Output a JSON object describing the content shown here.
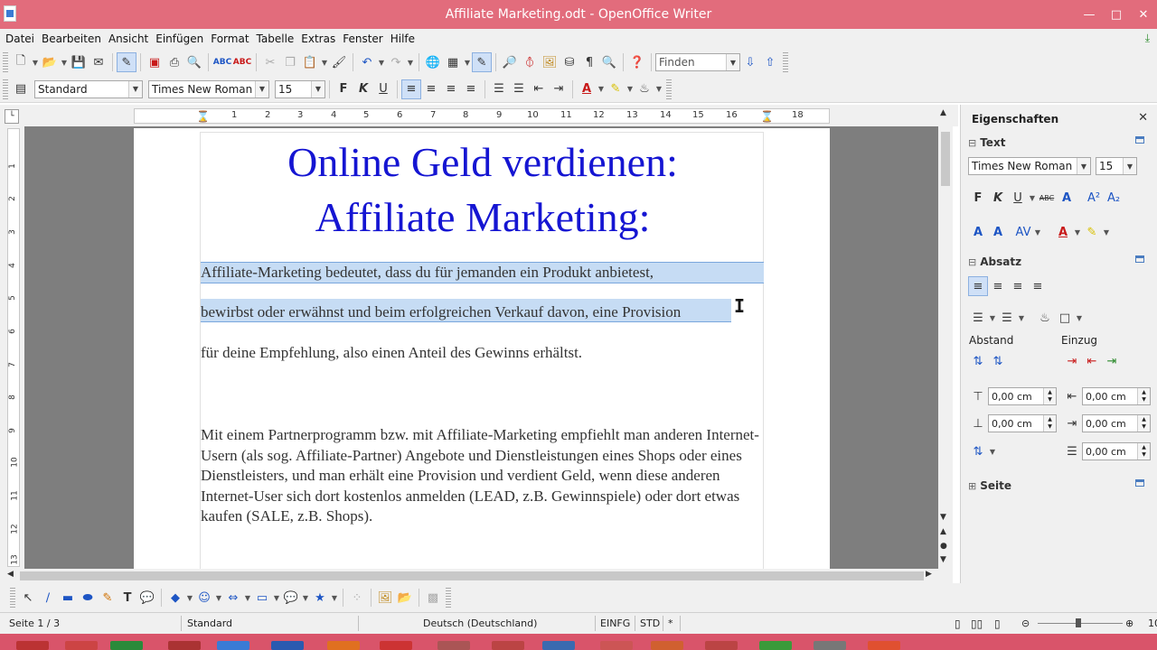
{
  "window": {
    "title": "Affiliate Marketing.odt - OpenOffice Writer"
  },
  "menu": [
    "Datei",
    "Bearbeiten",
    "Ansicht",
    "Einfügen",
    "Format",
    "Tabelle",
    "Extras",
    "Fenster",
    "Hilfe"
  ],
  "toolbar": {
    "find_placeholder": "Finden",
    "paragraph_style": "Standard",
    "font_name": "Times New Roman",
    "font_size": "15",
    "bold_label": "F",
    "italic_label": "K",
    "underline_label": "U"
  },
  "ruler": {
    "ticks": [
      "1",
      "2",
      "3",
      "4",
      "5",
      "6",
      "7",
      "8",
      "9",
      "10",
      "11",
      "12",
      "13",
      "14",
      "15",
      "16",
      "17",
      "18"
    ],
    "vticks": [
      "1",
      "2",
      "3",
      "4",
      "5",
      "6",
      "7",
      "8",
      "9",
      "10",
      "11",
      "12",
      "13"
    ]
  },
  "document": {
    "heading_line1": "Online Geld verdienen:",
    "heading_line2": "Affiliate Marketing:",
    "para1_line1": "Affiliate-Marketing bedeutet, dass du für jemanden ein Produkt anbietest,",
    "para1_line2": "bewirbst oder erwähnst und beim erfolgreichen Verkauf davon, eine Provision",
    "para1_line3": "für deine Empfehlung, also einen Anteil des Gewinns erhältst.",
    "para2": "Mit einem Partnerprogramm bzw. mit Affiliate-Marketing empfiehlt man anderen Internet-Usern (als sog. Affiliate-Partner) Angebote und Dienstleistungen eines Shops oder eines Dienstleisters, und man erhält eine Provision und verdient Geld, wenn diese anderen Internet-User sich dort kostenlos anmelden (LEAD, z.B. Gewinnspiele) oder dort etwas kaufen (SALE, z.B. Shops)."
  },
  "sidebar": {
    "title": "Eigenschaften",
    "text_section": "Text",
    "font_name": "Times New Roman",
    "font_size": "15",
    "paragraph_section": "Absatz",
    "spacing_label": "Abstand",
    "indent_label": "Einzug",
    "above_spacing": "0,00 cm",
    "below_spacing": "0,00 cm",
    "indent_before": "0,00 cm",
    "indent_after": "0,00 cm",
    "first_line": "0,00 cm",
    "page_section": "Seite"
  },
  "status": {
    "page": "Seite 1 / 3",
    "style": "Standard",
    "language": "Deutsch (Deutschland)",
    "insert_mode": "EINFG",
    "selection_mode": "STD",
    "modified": "*",
    "zoom": "10"
  }
}
